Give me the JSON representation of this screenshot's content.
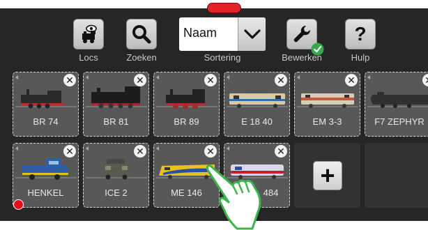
{
  "toolbar": {
    "locs_label": "Locs",
    "search_label": "Zoeken",
    "sort_value": "Naam",
    "sort_label": "Sortering",
    "edit_label": "Bewerken",
    "help_label": "Hulp",
    "help_glyph": "?"
  },
  "tiles": [
    {
      "name": "BR 74",
      "color": "#2a2a2a"
    },
    {
      "name": "BR 81",
      "color": "#1c1c1c"
    },
    {
      "name": "BR 89",
      "color": "#222222"
    },
    {
      "name": "E 18 40",
      "color": "#d8c9a0"
    },
    {
      "name": "EM 3-3",
      "color": "#c86a4a"
    },
    {
      "name": "F7 ZEPHYR",
      "color": "#303030"
    },
    {
      "name": "HENKEL",
      "color": "#2e5fa8"
    },
    {
      "name": "ICE 2",
      "color": "#5a5a50"
    },
    {
      "name": "ME 146",
      "color": "#e8c020"
    },
    {
      "name": "484",
      "color": "#d8d8e8"
    }
  ],
  "close_glyph": "✕",
  "add_glyph": "+",
  "colors": {
    "background": "#262626",
    "tile": "#585858",
    "active_indicator": "#e3101c",
    "edit_badge": "#35a84a"
  }
}
